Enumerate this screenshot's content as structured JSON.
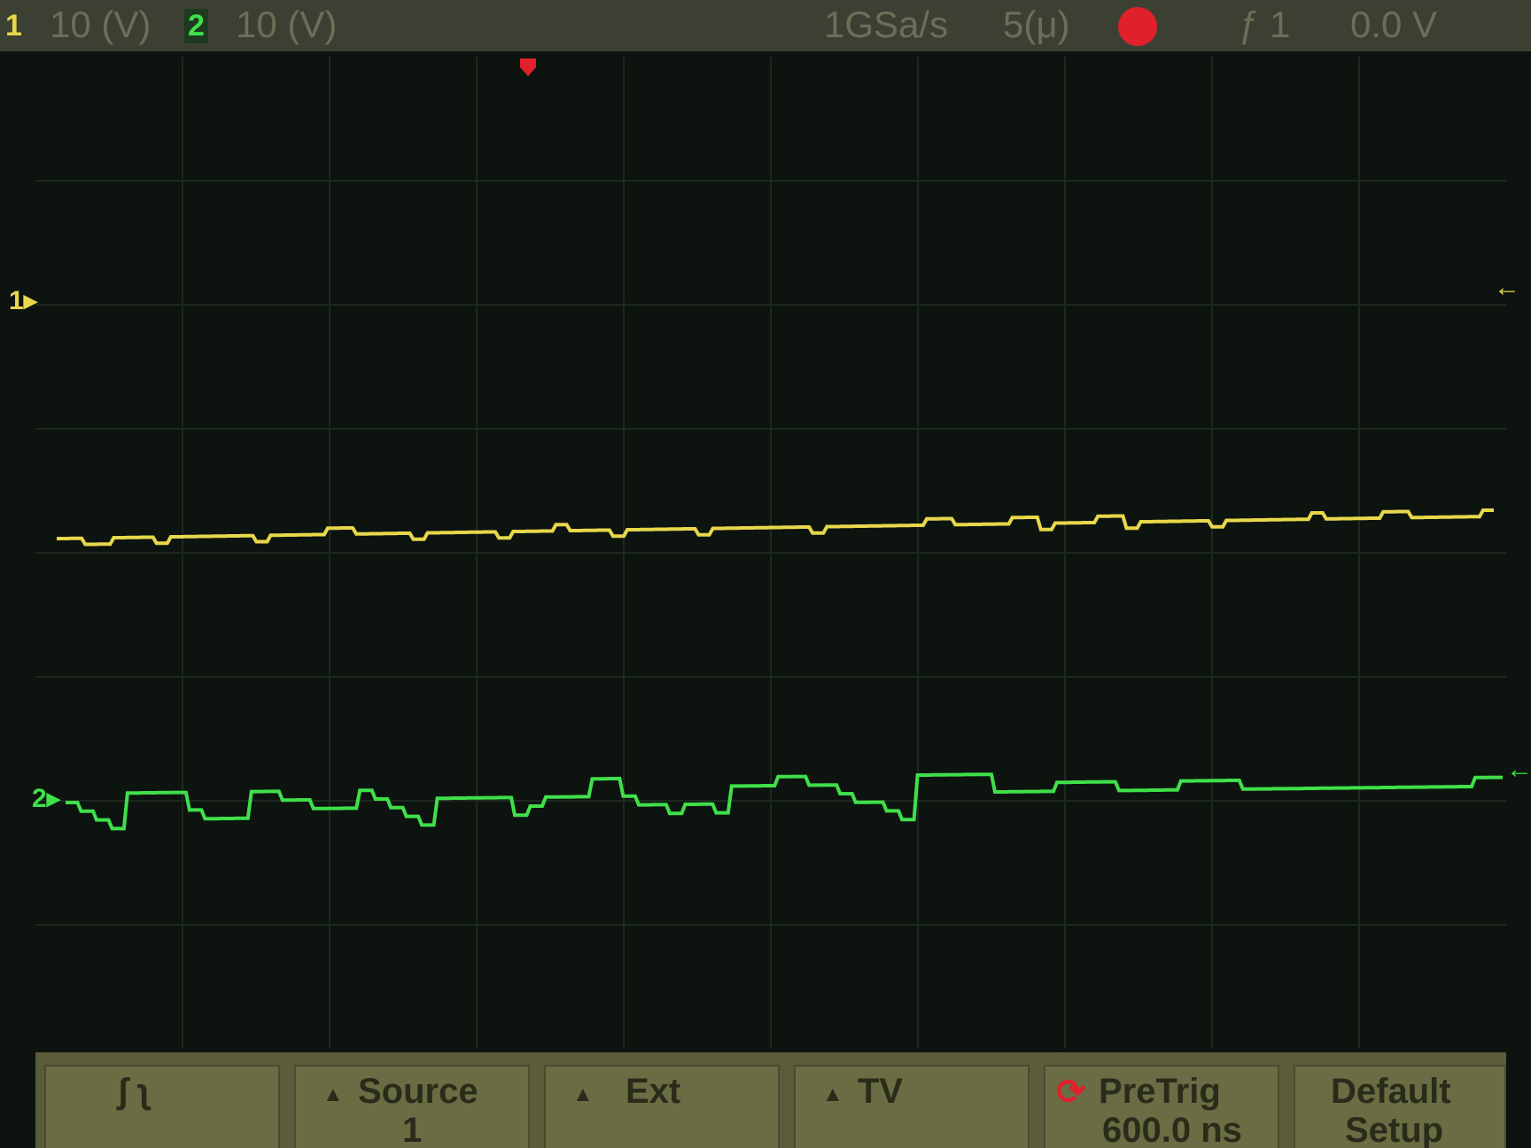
{
  "topbar": {
    "ch1_num": "1",
    "ch1_scale": "10 (V)",
    "ch2_num": "2",
    "ch2_scale": "10 (V)",
    "sample_rate": "1GSa/s",
    "time_scale": "5(μ)",
    "trigger_source": "ƒ 1",
    "trigger_level": "0.0 V",
    "run_state_icon": "stop-indicator",
    "colors": {
      "ch1": "#e8d84a",
      "ch2": "#3fe04a",
      "stop": "#e0202a"
    }
  },
  "markers": {
    "ch1_ground": "1",
    "ch2_ground": "2"
  },
  "softkeys": [
    {
      "label": "ʃ   ʅ",
      "sub": "",
      "icon": "slope-icon"
    },
    {
      "label": "Source",
      "sub": "1",
      "icon": "up-arrow-icon"
    },
    {
      "label": "Ext",
      "sub": "",
      "icon": "up-arrow-icon"
    },
    {
      "label": "TV",
      "sub": "",
      "icon": "up-arrow-icon"
    },
    {
      "label": "PreTrig",
      "sub": "600.0 ns",
      "icon": "rotate-knob-icon"
    },
    {
      "label": "Default",
      "sub": "Setup",
      "icon": ""
    }
  ],
  "traces": {
    "ch1": [
      0,
      0,
      -1,
      -1,
      0,
      0,
      0,
      -1,
      0,
      0,
      0,
      0,
      0,
      0,
      -1,
      0,
      0,
      0,
      0,
      1,
      1,
      0,
      0,
      0,
      0,
      -1,
      0,
      0,
      0,
      0,
      0,
      -1,
      0,
      0,
      0,
      1,
      0,
      0,
      0,
      -1,
      0,
      0,
      0,
      0,
      0,
      -1,
      0,
      0,
      0,
      0,
      0,
      0,
      0,
      -1,
      0,
      0,
      0,
      0,
      0,
      0,
      0,
      1,
      1,
      0,
      0,
      0,
      0,
      1,
      1,
      -1,
      0,
      0,
      0,
      1,
      1,
      -1,
      0,
      0,
      0,
      0,
      0,
      -1,
      0,
      0,
      0,
      0,
      0,
      0,
      1,
      0,
      0,
      0,
      0,
      1,
      1,
      0,
      0,
      0,
      0,
      0,
      1
    ],
    "ch2": [
      0,
      -1,
      -2,
      -3,
      1,
      1,
      1,
      1,
      -1,
      -2,
      -2,
      -2,
      1,
      1,
      0,
      0,
      -1,
      -1,
      -1,
      1,
      0,
      -1,
      -2,
      -3,
      0,
      0,
      0,
      0,
      0,
      -2,
      -1,
      0,
      0,
      0,
      2,
      2,
      0,
      -1,
      -1,
      -2,
      -1,
      -1,
      -2,
      1,
      1,
      1,
      2,
      2,
      1,
      1,
      0,
      -1,
      -1,
      -2,
      -3,
      2,
      2,
      2,
      2,
      2,
      0,
      0,
      0,
      0,
      1,
      1,
      1,
      1,
      0,
      0,
      0,
      0,
      1,
      1,
      1,
      1,
      0,
      0,
      0,
      0,
      0,
      0,
      0,
      0,
      0,
      0,
      0,
      0,
      0,
      0,
      0,
      1,
      1
    ]
  }
}
